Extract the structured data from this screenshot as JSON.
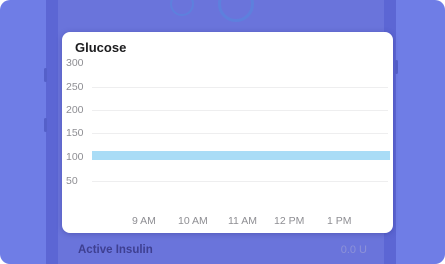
{
  "card": {
    "title": "Glucose",
    "y_ticks": [
      "300",
      "250",
      "200",
      "150",
      "100",
      "50"
    ],
    "x_ticks": [
      "9 AM",
      "10 AM",
      "11 AM",
      "12 PM",
      "1 PM"
    ]
  },
  "chart_data": {
    "type": "area",
    "title": "Glucose",
    "categories": [
      "9 AM",
      "10 AM",
      "11 AM",
      "12 PM",
      "1 PM"
    ],
    "ylim": [
      0,
      300
    ],
    "target_range": [
      100,
      120
    ],
    "grid": true
  },
  "bottom": {
    "label": "Active Insulin",
    "value": "0.0 U"
  },
  "colors": {
    "background": "#6f7de6",
    "band": "#a9dcf6",
    "label": "#3e3f91"
  }
}
